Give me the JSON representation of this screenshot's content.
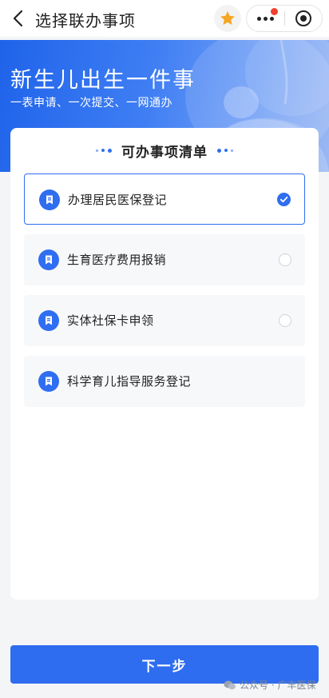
{
  "navbar": {
    "title": "选择联办事项",
    "back_icon": "chevron-left-icon",
    "star_icon": "star-icon",
    "star_color": "#f5a623",
    "more_icon": "more-dots-icon",
    "notification_color": "#f0412e",
    "target_icon": "target-icon"
  },
  "banner": {
    "title": "新生儿出生一件事",
    "subtitle": "一表申请、一次提交、一网通办"
  },
  "card": {
    "title": "可办事项清单",
    "items": [
      {
        "label": "办理居民医保登记",
        "state": "checked"
      },
      {
        "label": "生育医疗费用报销",
        "state": "unchecked"
      },
      {
        "label": "实体社保卡申领",
        "state": "unchecked"
      },
      {
        "label": "科学育儿指导服务登记",
        "state": "none"
      }
    ]
  },
  "footer": {
    "next_label": "下一步",
    "watermark": "公众号 · 广丰医保"
  },
  "colors": {
    "accent": "#2f6ef0",
    "background": "#f4f5f7"
  }
}
